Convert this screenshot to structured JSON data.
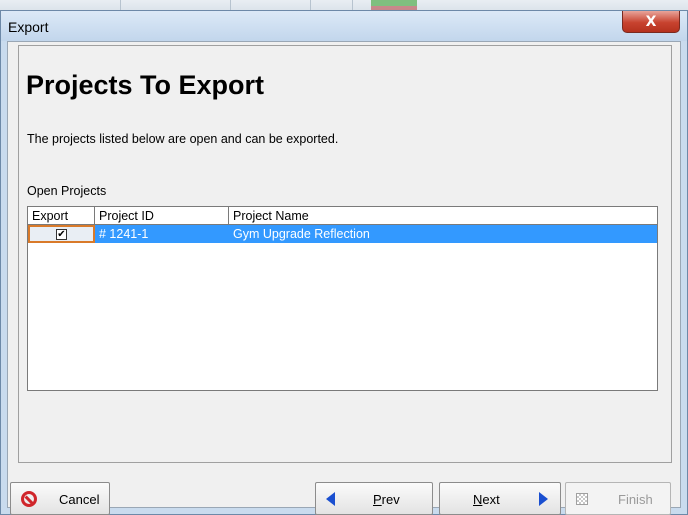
{
  "window": {
    "title": "Export",
    "close_glyph": "X"
  },
  "page": {
    "heading": "Projects To Export",
    "description": "The projects listed below are open and can be exported.",
    "group_label": "Open Projects"
  },
  "projects_table": {
    "columns": [
      "Export",
      "Project ID",
      "Project Name"
    ],
    "rows": [
      {
        "export_checked": true,
        "check_glyph": "✔",
        "project_id": "# 1241-1",
        "project_name": "Gym Upgrade Reflection",
        "selected": true
      }
    ]
  },
  "buttons": {
    "cancel": {
      "label": "Cancel",
      "icon": "cancel-circle-icon",
      "enabled": true
    },
    "prev": {
      "mnemonic": "P",
      "rest": "rev",
      "icon": "arrow-left-icon",
      "enabled": true
    },
    "next": {
      "mnemonic": "N",
      "rest": "ext",
      "icon": "arrow-right-icon",
      "enabled": true
    },
    "finish": {
      "label": "Finish",
      "icon": "finish-flag-icon",
      "enabled": false
    }
  },
  "colors": {
    "selection": "#3399ff",
    "focus_border": "#d97a2a",
    "close_button": "#c8432f",
    "arrow": "#1a4fd0",
    "cancel_icon": "#d0262b"
  }
}
